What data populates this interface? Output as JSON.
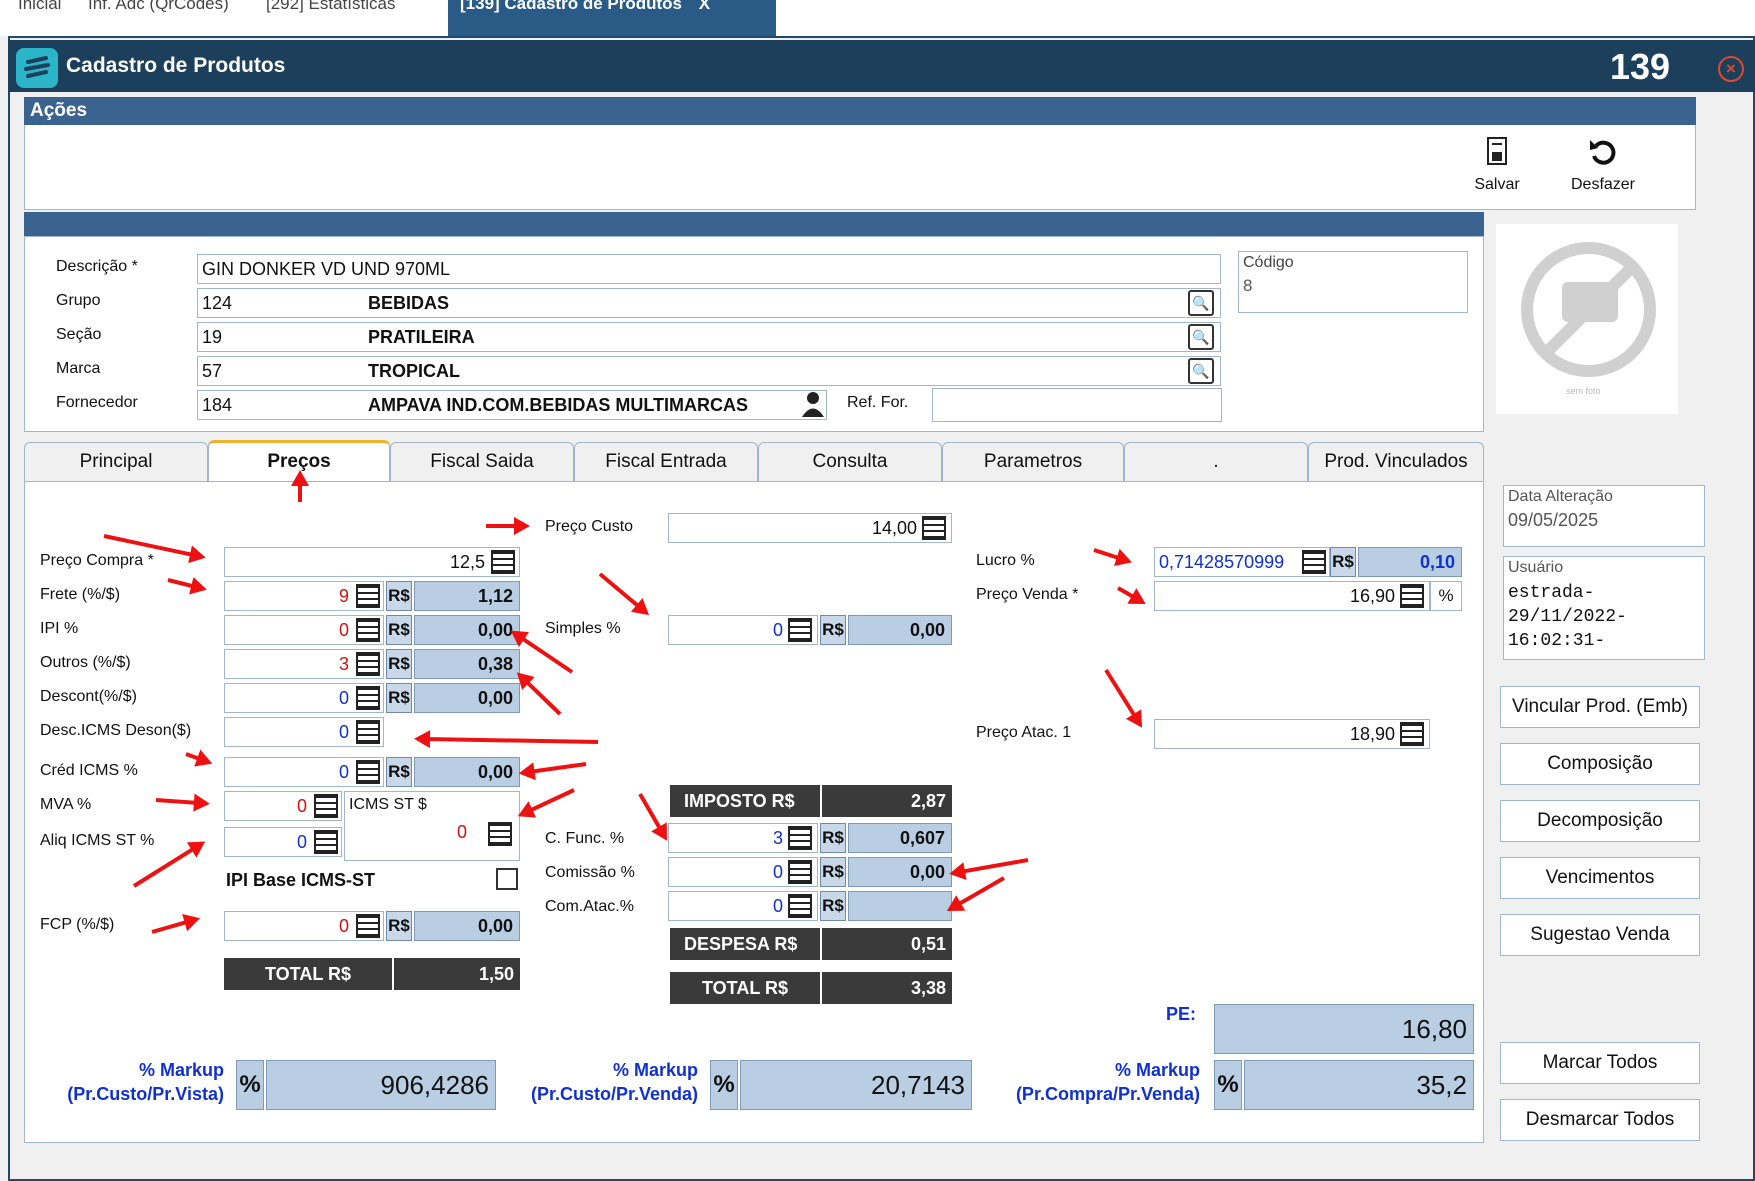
{
  "top_tabs": [
    {
      "label": "Inicial"
    },
    {
      "label": "Inf. Adc (QrCodes)"
    },
    {
      "label": "[292] Estatísticas"
    },
    {
      "label": "[139] Cadastro de Produtos"
    }
  ],
  "top_tabs_close": "X",
  "window": {
    "title": "Cadastro de Produtos",
    "number": "139",
    "close_glyph": "×"
  },
  "acoes": {
    "header": "Ações",
    "save_label": "Salvar",
    "undo_label": "Desfazer"
  },
  "form": {
    "descricao_label": "Descrição *",
    "descricao_value": "GIN DONKER VD UND 970ML",
    "grupo_label": "Grupo",
    "grupo_code": "124",
    "grupo_name": "BEBIDAS",
    "secao_label": "Seção",
    "secao_code": "19",
    "secao_name": "PRATILEIRA",
    "marca_label": "Marca",
    "marca_code": "57",
    "marca_name": "TROPICAL",
    "fornecedor_label": "Fornecedor",
    "fornecedor_code": "184",
    "fornecedor_name": "AMPAVA IND.COM.BEBIDAS MULTIMARCAS",
    "ref_for_label": "Ref. For.",
    "ref_for_value": "",
    "codigo_label": "Código",
    "codigo_value": "8",
    "photo_caption": "sem foto"
  },
  "tabs": [
    "Principal",
    "Preços",
    "Fiscal Saida",
    "Fiscal Entrada",
    "Consulta",
    "Parametros",
    ".",
    "Prod. Vinculados"
  ],
  "precos": {
    "rs": "R$",
    "pct": "%",
    "preco_custo_label": "Preço Custo",
    "preco_custo": "14,00",
    "preco_compra_label": "Preço Compra *",
    "preco_compra": "12,5",
    "frete_label": "Frete (%/$)",
    "frete_pct": "9",
    "frete_val": "1,12",
    "ipi_label": "IPI %",
    "ipi_pct": "0",
    "ipi_val": "0,00",
    "outros_label": "Outros (%/$)",
    "outros_pct": "3",
    "outros_val": "0,38",
    "descont_label": "Descont(%/$)",
    "descont_pct": "0",
    "descont_val": "0,00",
    "desc_icms_label": "Desc.ICMS Deson($)",
    "desc_icms": "0",
    "cred_icms_label": "Créd ICMS %",
    "cred_icms_pct": "0",
    "cred_icms_val": "0,00",
    "mva_label": "MVA %",
    "mva": "0",
    "icms_st_label": "ICMS ST $",
    "icms_st": "0",
    "aliq_icms_st_label": "Aliq ICMS ST %",
    "aliq_icms_st": "0",
    "ipi_base_label": "IPI Base ICMS-ST",
    "fcp_label": "FCP (%/$)",
    "fcp_pct": "0",
    "fcp_val": "0,00",
    "total_label": "TOTAL R$",
    "total_val": "1,50",
    "simples_label": "Simples %",
    "simples_pct": "0",
    "simples_val": "0,00",
    "imposto_label": "IMPOSTO R$",
    "imposto_val": "2,87",
    "c_func_label": "C. Func. %",
    "c_func_pct": "3",
    "c_func_val": "0,607",
    "comissao_label": "Comissão %",
    "comissao_pct": "0",
    "comissao_val": "0,00",
    "com_atac_label": "Com.Atac.%",
    "com_atac_pct": "0",
    "com_atac_val": "",
    "despesa_label": "DESPESA R$",
    "despesa_val": "0,51",
    "total2_label": "TOTAL R$",
    "total2_val": "3,38",
    "lucro_label": "Lucro %",
    "lucro_pct": "0,71428570999",
    "lucro_val": "0,10",
    "preco_venda_label": "Preço Venda *",
    "preco_venda": "16,90",
    "preco_atac_label": "Preço Atac. 1",
    "preco_atac": "18,90",
    "pe_label": "PE:",
    "pe_val": "16,80",
    "markup1_line1": "% Markup",
    "markup1_line2": "(Pr.Custo/Pr.Vista)",
    "markup1_val": "906,4286",
    "markup2_line1": "% Markup",
    "markup2_line2": "(Pr.Custo/Pr.Venda)",
    "markup2_val": "20,7143",
    "markup3_line1": "% Markup",
    "markup3_line2": "(Pr.Compra/Pr.Venda)",
    "markup3_val": "35,2"
  },
  "side": {
    "data_alteracao_label": "Data Alteração",
    "data_alteracao": "09/05/2025",
    "usuario_label": "Usuário",
    "usuario_line1": "estrada-",
    "usuario_line2": "29/11/2022-",
    "usuario_line3": "16:02:31-",
    "buttons": [
      "Vincular Prod. (Emb)",
      "Composição",
      "Decomposição",
      "Vencimentos",
      "Sugestao Venda"
    ],
    "marcar_todos": "Marcar Todos",
    "desmarcar_todos": "Desmarcar Todos"
  },
  "colors": {
    "title_bar": "#1c3f5c",
    "section_header": "#3b6390",
    "value_cell": "#b9cde3",
    "negative_red": "#d21010",
    "accent_blue": "#1030d0",
    "arrow_red": "#ee1111"
  }
}
